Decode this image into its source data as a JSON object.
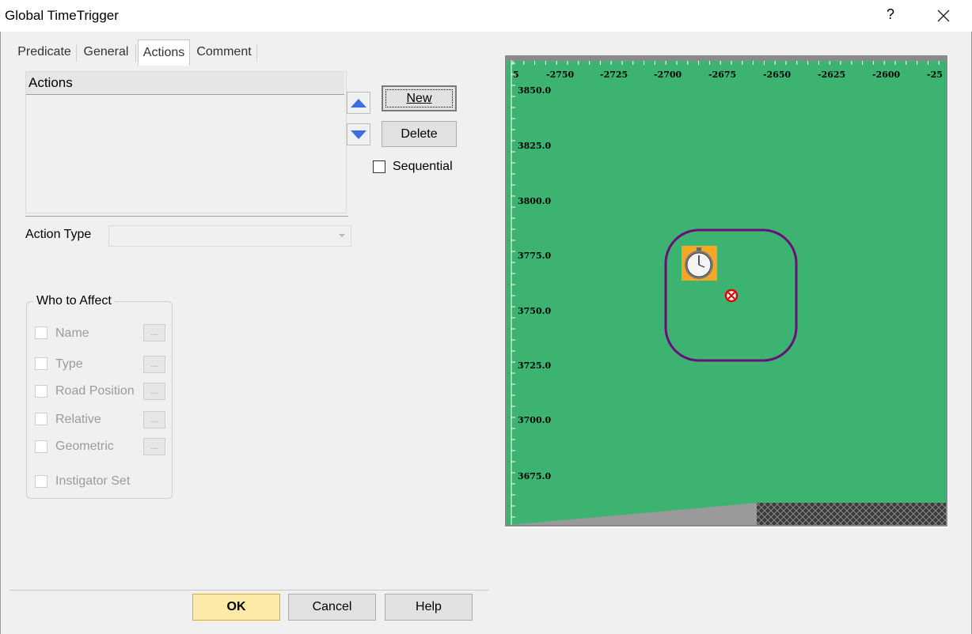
{
  "window": {
    "title": "Global TimeTrigger",
    "help_glyph": "?",
    "close_icon": "close-icon"
  },
  "tabs": [
    {
      "label": "Predicate",
      "mnemonic": "P"
    },
    {
      "label": "General",
      "mnemonic": "G"
    },
    {
      "label": "Actions",
      "mnemonic": "A",
      "selected": true
    },
    {
      "label": "Comment",
      "mnemonic": ""
    }
  ],
  "actions_list": {
    "header": "Actions",
    "items": []
  },
  "buttons": {
    "new": "New",
    "delete": "Delete",
    "ok": "OK",
    "cancel": "Cancel",
    "help": "Help"
  },
  "sequential": {
    "label": "Sequential",
    "checked": false
  },
  "action_type": {
    "label": "Action Type",
    "value": ""
  },
  "who_to_affect": {
    "title": "Who to Affect",
    "items": [
      {
        "label": "Name",
        "checked": false
      },
      {
        "label": "Type",
        "checked": false
      },
      {
        "label": "Road Position",
        "checked": false
      },
      {
        "label": "Relative",
        "checked": false
      },
      {
        "label": "Geometric",
        "checked": false
      }
    ],
    "instigator_set": {
      "label": "Instigator Set",
      "checked": false
    },
    "dots_label": "..."
  },
  "map": {
    "x_ticks": [
      "5",
      "-2750",
      "-2725",
      "-2700",
      "-2675",
      "-2650",
      "-2625",
      "-2600",
      "-25"
    ],
    "y_ticks": [
      "3850.0",
      "3825.0",
      "3800.0",
      "3775.0",
      "3750.0",
      "3725.0",
      "3700.0",
      "3675.0"
    ],
    "colors": {
      "terrain": "#3cb371",
      "trigger_region": "#6a0f7a",
      "road": "#9a9a9a",
      "hatch": "#3a3a3a",
      "timer_bg": "#f5a623"
    },
    "icons": [
      "stopwatch-icon",
      "target-marker-icon"
    ]
  }
}
